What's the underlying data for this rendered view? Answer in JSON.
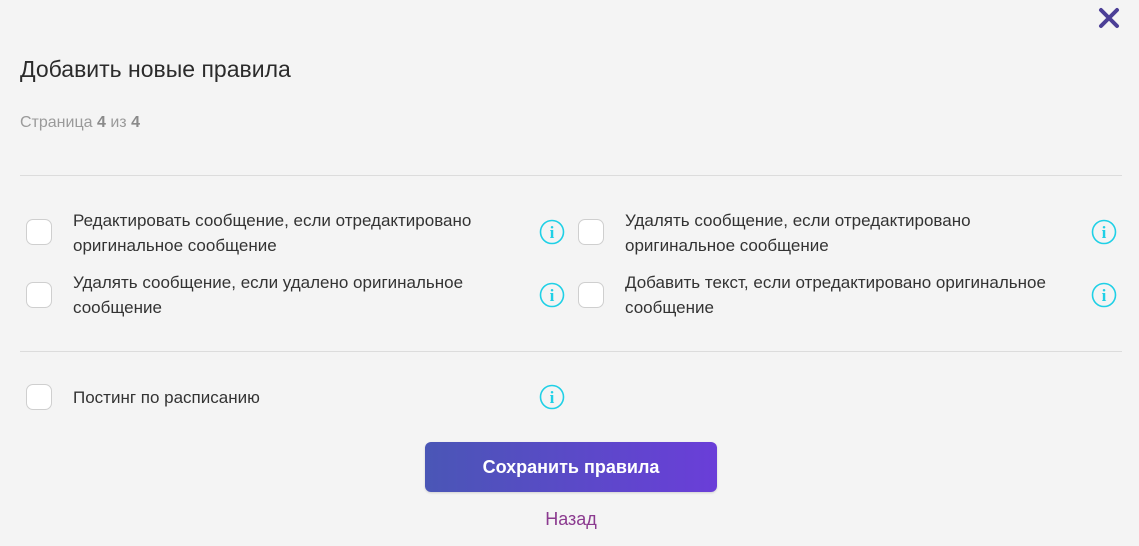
{
  "dialog": {
    "title": "Добавить новые правила",
    "close_icon": "close-icon"
  },
  "pagination": {
    "prefix": "Страница",
    "current": "4",
    "separator": "из",
    "total": "4"
  },
  "rules": [
    {
      "label": "Редактировать сообщение, если отредактировано оригинальное сообщение",
      "checked": false
    },
    {
      "label": "Удалять сообщение, если отредактировано оригинальное сообщение",
      "checked": false
    },
    {
      "label": "Удалять сообщение, если удалено оригинальное сообщение",
      "checked": false
    },
    {
      "label": "Добавить текст, если отредактировано оригинальное сообщение",
      "checked": false
    }
  ],
  "scheduling": {
    "label": "Постинг по расписанию",
    "checked": false
  },
  "actions": {
    "save_label": "Сохранить правила",
    "back_label": "Назад"
  },
  "colors": {
    "accent_gradient_start": "#4a56b6",
    "accent_gradient_end": "#6a3ed8",
    "close_icon": "#4c3f96",
    "info_icon": "#1fd0e6",
    "back_link": "#8b3a8f"
  }
}
